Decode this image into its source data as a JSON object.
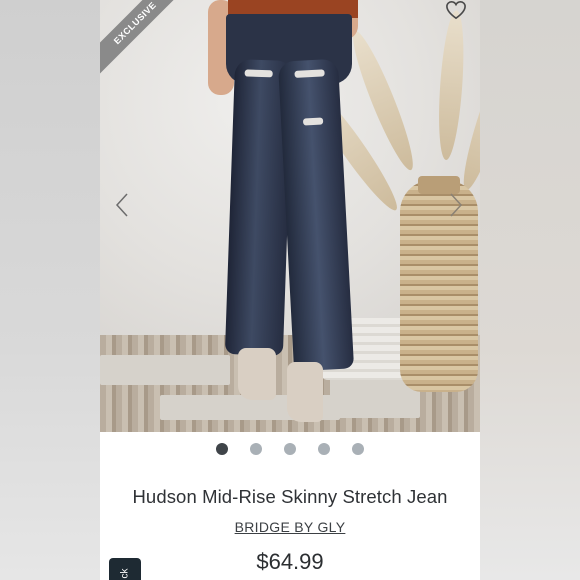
{
  "product": {
    "badge": "EXCLUSIVE",
    "title": "Hudson Mid-Rise Skinny Stretch Jean",
    "brand": "BRIDGE BY GLY",
    "price": "$64.99"
  },
  "carousel": {
    "slide_count": 5,
    "active_index": 0
  },
  "feedback_tab": {
    "label": "ck"
  },
  "icons": {
    "favorite": "heart-outline-icon",
    "prev": "chevron-left-icon",
    "next": "chevron-right-icon"
  },
  "colors": {
    "dot_active": "#3f4449",
    "dot_inactive": "#a9b0b6",
    "badge_bg": "#8a8a8a",
    "text": "#2f3236"
  }
}
